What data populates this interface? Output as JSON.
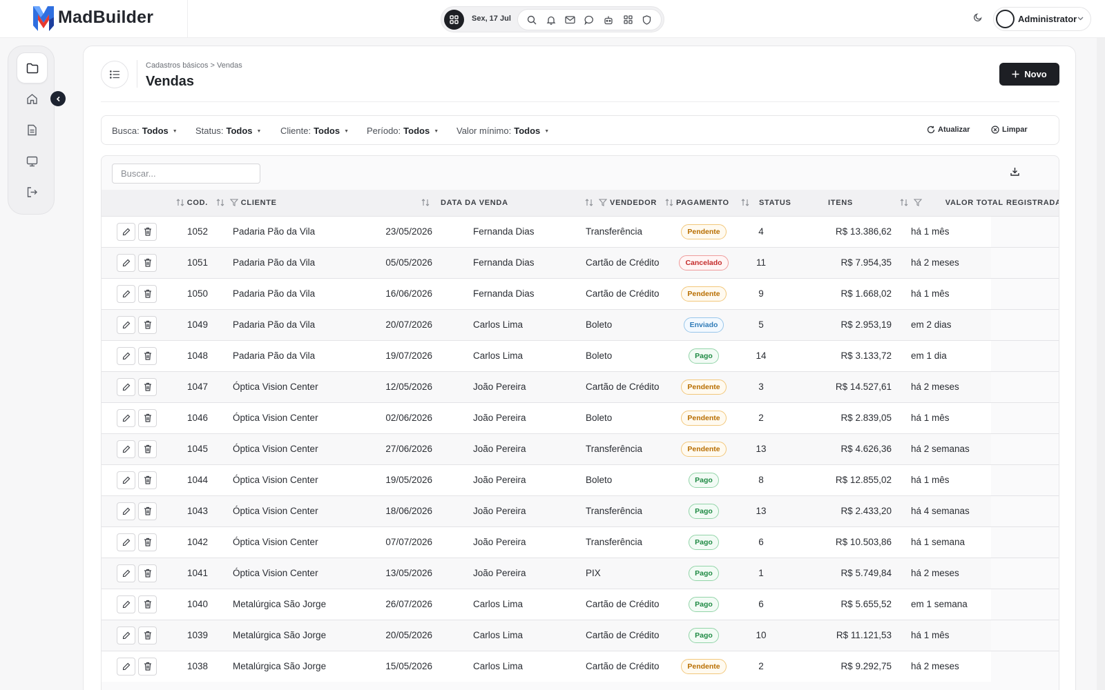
{
  "brand": {
    "name": "MadBuilder"
  },
  "topbar": {
    "date": "Sex, 17 Jul",
    "user_name": "Administrator"
  },
  "page": {
    "breadcrumb": "Cadastros básicos > Vendas",
    "title": "Vendas",
    "new_button": "Novo"
  },
  "filters": [
    {
      "label": "Busca:",
      "value": "Todos"
    },
    {
      "label": "Status:",
      "value": "Todos"
    },
    {
      "label": "Cliente:",
      "value": "Todos"
    },
    {
      "label": "Período:",
      "value": "Todos"
    },
    {
      "label": "Valor mínimo:",
      "value": "Todos"
    }
  ],
  "filter_actions": {
    "refresh": "Atualizar",
    "clear": "Limpar"
  },
  "search": {
    "placeholder": "Buscar..."
  },
  "columns": {
    "cod": "COD.",
    "cliente": "CLIENTE",
    "data": "DATA DA VENDA",
    "vendedor": "VENDEDOR",
    "pagamento": "PAGAMENTO",
    "status": "STATUS",
    "itens": "ITENS",
    "valor": "VALOR TOTAL",
    "registrada": "REGISTRADA"
  },
  "status_colors": {
    "Pendente": {
      "text": "#b86e00",
      "border": "#f2c77a",
      "bg": "#fffaf0"
    },
    "Cancelado": {
      "text": "#c42b2b",
      "border": "#ef9b9b",
      "bg": "#fff5f5"
    },
    "Enviado": {
      "text": "#2f7bb8",
      "border": "#98c6ea",
      "bg": "#f3f9ff"
    },
    "Pago": {
      "text": "#1f8a44",
      "border": "#92d4a8",
      "bg": "#f2fbf5"
    }
  },
  "rows": [
    {
      "cod": "1052",
      "cliente": "Padaria Pão da Vila",
      "data": "23/05/2026",
      "vendedor": "Fernanda Dias",
      "pagamento": "Transferência",
      "status": "Pendente",
      "itens": "4",
      "valor": "R$ 13.386,62",
      "registrada": "há 1 mês"
    },
    {
      "cod": "1051",
      "cliente": "Padaria Pão da Vila",
      "data": "05/05/2026",
      "vendedor": "Fernanda Dias",
      "pagamento": "Cartão de Crédito",
      "status": "Cancelado",
      "itens": "11",
      "valor": "R$ 7.954,35",
      "registrada": "há 2 meses"
    },
    {
      "cod": "1050",
      "cliente": "Padaria Pão da Vila",
      "data": "16/06/2026",
      "vendedor": "Fernanda Dias",
      "pagamento": "Cartão de Crédito",
      "status": "Pendente",
      "itens": "9",
      "valor": "R$ 1.668,02",
      "registrada": "há 1 mês"
    },
    {
      "cod": "1049",
      "cliente": "Padaria Pão da Vila",
      "data": "20/07/2026",
      "vendedor": "Carlos Lima",
      "pagamento": "Boleto",
      "status": "Enviado",
      "itens": "5",
      "valor": "R$ 2.953,19",
      "registrada": "em 2 dias"
    },
    {
      "cod": "1048",
      "cliente": "Padaria Pão da Vila",
      "data": "19/07/2026",
      "vendedor": "Carlos Lima",
      "pagamento": "Boleto",
      "status": "Pago",
      "itens": "14",
      "valor": "R$ 3.133,72",
      "registrada": "em 1 dia"
    },
    {
      "cod": "1047",
      "cliente": "Óptica Vision Center",
      "data": "12/05/2026",
      "vendedor": "João Pereira",
      "pagamento": "Cartão de Crédito",
      "status": "Pendente",
      "itens": "3",
      "valor": "R$ 14.527,61",
      "registrada": "há 2 meses"
    },
    {
      "cod": "1046",
      "cliente": "Óptica Vision Center",
      "data": "02/06/2026",
      "vendedor": "João Pereira",
      "pagamento": "Boleto",
      "status": "Pendente",
      "itens": "2",
      "valor": "R$ 2.839,05",
      "registrada": "há 1 mês"
    },
    {
      "cod": "1045",
      "cliente": "Óptica Vision Center",
      "data": "27/06/2026",
      "vendedor": "João Pereira",
      "pagamento": "Transferência",
      "status": "Pendente",
      "itens": "13",
      "valor": "R$ 4.626,36",
      "registrada": "há 2 semanas"
    },
    {
      "cod": "1044",
      "cliente": "Óptica Vision Center",
      "data": "19/05/2026",
      "vendedor": "João Pereira",
      "pagamento": "Boleto",
      "status": "Pago",
      "itens": "8",
      "valor": "R$ 12.855,02",
      "registrada": "há 1 mês"
    },
    {
      "cod": "1043",
      "cliente": "Óptica Vision Center",
      "data": "18/06/2026",
      "vendedor": "João Pereira",
      "pagamento": "Transferência",
      "status": "Pago",
      "itens": "13",
      "valor": "R$ 2.433,20",
      "registrada": "há 4 semanas"
    },
    {
      "cod": "1042",
      "cliente": "Óptica Vision Center",
      "data": "07/07/2026",
      "vendedor": "João Pereira",
      "pagamento": "Transferência",
      "status": "Pago",
      "itens": "6",
      "valor": "R$ 10.503,86",
      "registrada": "há 1 semana"
    },
    {
      "cod": "1041",
      "cliente": "Óptica Vision Center",
      "data": "13/05/2026",
      "vendedor": "João Pereira",
      "pagamento": "PIX",
      "status": "Pago",
      "itens": "1",
      "valor": "R$ 5.749,84",
      "registrada": "há 2 meses"
    },
    {
      "cod": "1040",
      "cliente": "Metalúrgica São Jorge",
      "data": "26/07/2026",
      "vendedor": "Carlos Lima",
      "pagamento": "Cartão de Crédito",
      "status": "Pago",
      "itens": "6",
      "valor": "R$ 5.655,52",
      "registrada": "em 1 semana"
    },
    {
      "cod": "1039",
      "cliente": "Metalúrgica São Jorge",
      "data": "20/05/2026",
      "vendedor": "Carlos Lima",
      "pagamento": "Cartão de Crédito",
      "status": "Pago",
      "itens": "10",
      "valor": "R$ 11.121,53",
      "registrada": "há 1 mês"
    },
    {
      "cod": "1038",
      "cliente": "Metalúrgica São Jorge",
      "data": "15/05/2026",
      "vendedor": "Carlos Lima",
      "pagamento": "Cartão de Crédito",
      "status": "Pendente",
      "itens": "2",
      "valor": "R$ 9.292,75",
      "registrada": "há 2 meses"
    }
  ],
  "icons": {
    "topbar": [
      "search-icon",
      "bell-icon",
      "mail-icon",
      "chat-icon",
      "robot-icon",
      "grid-icon",
      "shield-icon"
    ],
    "sidenav": [
      "folder-icon",
      "home-icon",
      "document-icon",
      "monitor-icon",
      "logout-icon"
    ]
  }
}
